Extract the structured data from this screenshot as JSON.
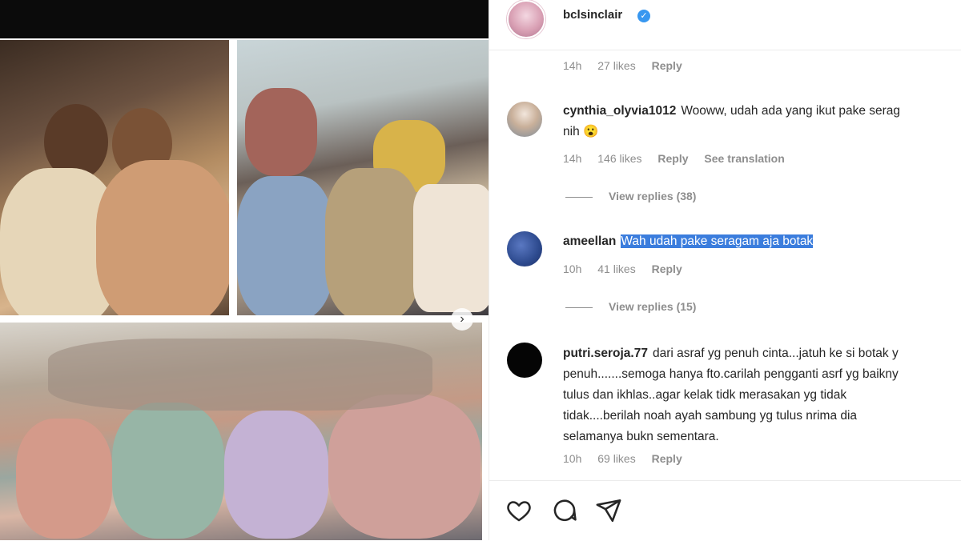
{
  "post": {
    "username": "bclsinclair",
    "verified": true
  },
  "comments": [
    {
      "time": "14h",
      "likes": "27 likes",
      "reply": "Reply"
    },
    {
      "username": "cynthia_olyvia1012",
      "text_line1": "Wooww, udah ada yang ikut pake serag",
      "text_line2": "nih 😮",
      "time": "14h",
      "likes": "146 likes",
      "reply": "Reply",
      "translation": "See translation",
      "view_replies": "View replies (38)"
    },
    {
      "username": "ameellan",
      "text": "Wah udah pake seragam aja botak",
      "time": "10h",
      "likes": "41 likes",
      "reply": "Reply",
      "view_replies": "View replies (15)"
    },
    {
      "username": "putri.seroja.77",
      "line1": "dari asraf yg penuh cinta...jatuh ke si botak y",
      "line2": "penuh.......semoga hanya fto.carilah pengganti asrf yg baikny",
      "line3": "tulus dan ikhlas..agar kelak tidk merasakan yg tidak",
      "line4": "tidak....berilah noah ayah sambung yg tulus nrima dia",
      "line5": "selamanya bukn sementara.",
      "time": "10h",
      "likes": "69 likes",
      "reply": "Reply"
    }
  ],
  "actions": {
    "like_icon": "heart-icon",
    "comment_icon": "comment-icon",
    "share_icon": "send-icon"
  },
  "colors": {
    "verified": "#3897f0",
    "highlight": "#3b7ddd",
    "muted_text": "#8e8e8e"
  }
}
